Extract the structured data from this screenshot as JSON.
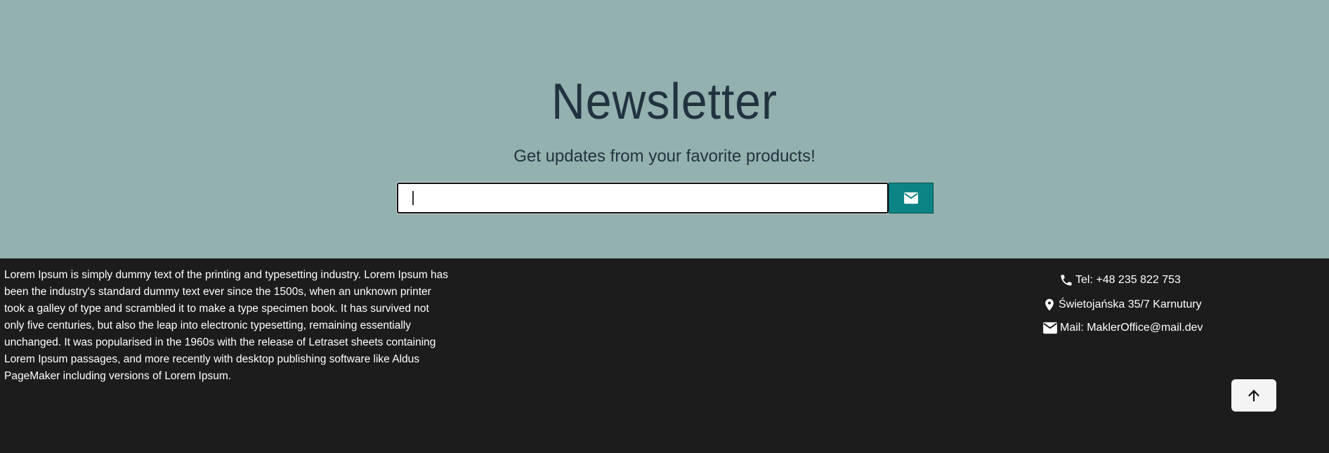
{
  "newsletter": {
    "title": "Newsletter",
    "subtitle": "Get updates from your favorite products!",
    "email_value": "",
    "email_placeholder": "",
    "submit_icon": "mail-icon",
    "background_color": "#93b1ae",
    "accent_color": "#0c8486"
  },
  "footer": {
    "about_text": "Lorem Ipsum is simply dummy text of the printing and typesetting industry. Lorem Ipsum has been the industry's standard dummy text ever since the 1500s, when an unknown printer took a galley of type and scrambled it to make a type specimen book. It has survived not only five centuries, but also the leap into electronic typesetting, remaining essentially unchanged. It was popularised in the 1960s with the release of Letraset sheets containing Lorem Ipsum passages, and more recently with desktop publishing software like Aldus PageMaker including versions of Lorem Ipsum.",
    "contact": {
      "phone": "Tel: +48 235 822 753",
      "phone_icon": "phone-icon",
      "address": "Świetojańska 35/7 Karnutury",
      "address_icon": "location-pin-icon",
      "mail": "Mail: MaklerOffice@mail.dev",
      "mail_icon": "mail-icon"
    },
    "scroll_top_icon": "arrow-up-icon",
    "background_color": "#1c1c1c"
  }
}
